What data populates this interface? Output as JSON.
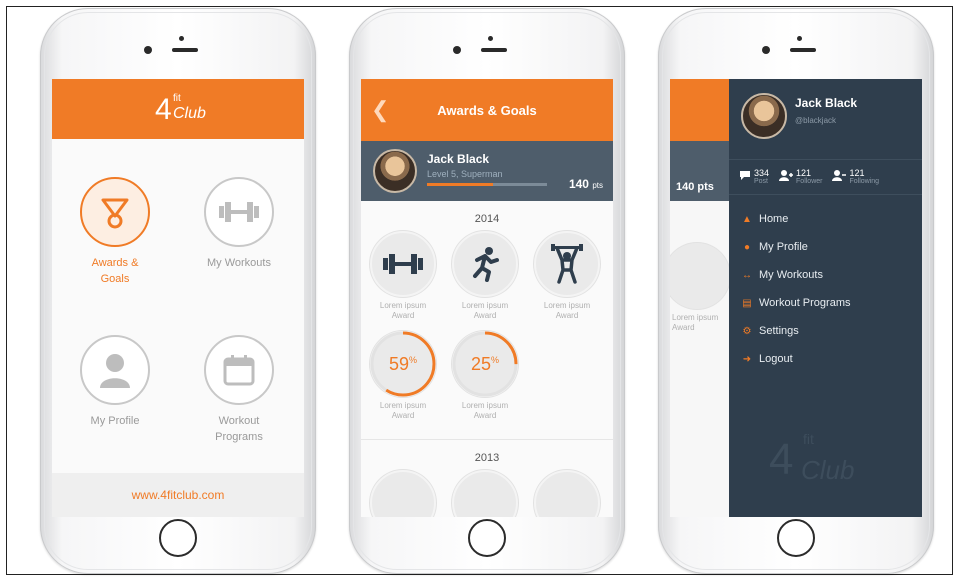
{
  "colors": {
    "accent": "#f07b26",
    "dark": "#2f3e4d",
    "slate": "#4e5d6b"
  },
  "logo": {
    "number": "4",
    "sup": "fit",
    "word": "Club"
  },
  "home": {
    "tiles": [
      {
        "label1": "Awards &",
        "label2": "Goals",
        "icon": "medal-icon"
      },
      {
        "label1": "My Workouts",
        "label2": "",
        "icon": "dumbbell-icon"
      },
      {
        "label1": "My Profile",
        "label2": "",
        "icon": "person-icon"
      },
      {
        "label1": "Workout",
        "label2": "Programs",
        "icon": "calendar-icon"
      }
    ],
    "footer_link": "www.4fitclub.com"
  },
  "awards_screen": {
    "title": "Awards & Goals",
    "back_icon": "chevron-left-icon",
    "user": {
      "name": "Jack Black",
      "level": "Level 5, Superman",
      "progress": 0.55,
      "points": "140",
      "points_unit": "pts"
    },
    "years": [
      "2014",
      "2013"
    ],
    "awards": [
      {
        "label1": "Lorem ipsum",
        "label2": "Award",
        "icon": "dumbbell-icon"
      },
      {
        "label1": "Lorem ipsum",
        "label2": "Award",
        "icon": "runner-icon"
      },
      {
        "label1": "Lorem ipsum",
        "label2": "Award",
        "icon": "weightlifter-icon"
      },
      {
        "label1": "Lorem ipsum",
        "label2": "Award",
        "percent": "59",
        "progress": 0.59
      },
      {
        "label1": "Lorem ipsum",
        "label2": "Award",
        "percent": "25",
        "progress": 0.25
      }
    ],
    "pct_sign": "%"
  },
  "menu_screen": {
    "name": "Jack Black",
    "handle": "@blackjack",
    "peek_points": "140 pts",
    "peek_label1": "Lorem ipsum",
    "peek_label2": "Award",
    "stats": [
      {
        "value": "334",
        "label": "Post",
        "icon": "comment-icon"
      },
      {
        "value": "121",
        "label": "Follower",
        "icon": "follower-icon"
      },
      {
        "value": "121",
        "label": "Following",
        "icon": "following-icon"
      }
    ],
    "items": [
      {
        "label": "Home",
        "icon": "home-icon"
      },
      {
        "label": "My Profile",
        "icon": "person-icon"
      },
      {
        "label": "My Workouts",
        "icon": "dumbbell-icon"
      },
      {
        "label": "Workout Programs",
        "icon": "calendar-icon"
      },
      {
        "label": "Settings",
        "icon": "gear-icon"
      },
      {
        "label": "Logout",
        "icon": "logout-icon"
      }
    ]
  }
}
